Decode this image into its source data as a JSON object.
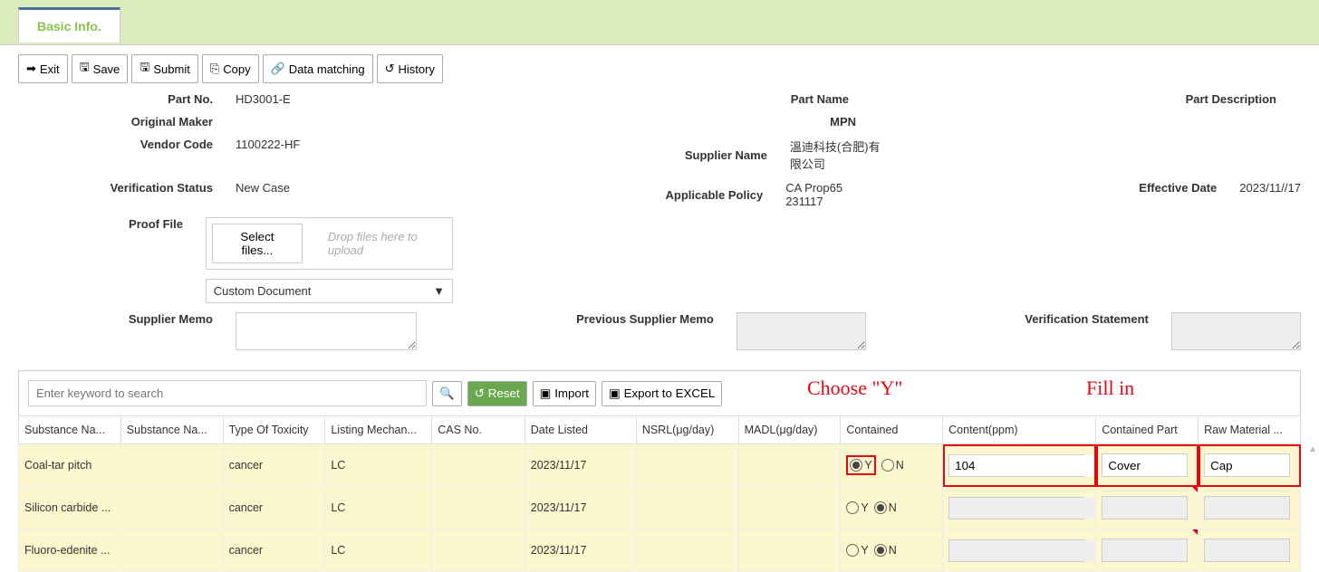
{
  "tab": "Basic Info.",
  "toolbar": {
    "exit": "Exit",
    "save": "Save",
    "submit": "Submit",
    "copy": "Copy",
    "data_matching": "Data matching",
    "history": "History"
  },
  "labels": {
    "part_no": "Part No.",
    "part_name": "Part Name",
    "part_desc": "Part Description",
    "original_maker": "Original Maker",
    "mpn": "MPN",
    "vendor_code": "Vendor Code",
    "supplier_name": "Supplier Name",
    "verification_status": "Verification Status",
    "applicable_policy": "Applicable Policy",
    "effective_date": "Effective Date",
    "proof_file": "Proof File",
    "supplier_memo": "Supplier Memo",
    "prev_supplier_memo": "Previous Supplier Memo",
    "verification_statement": "Verification Statement"
  },
  "values": {
    "part_no": "HD3001-E",
    "vendor_code": "1100222-HF",
    "supplier_name": "溫迪科技(合肥)有限公司",
    "verification_status": "New Case",
    "applicable_policy": "CA Prop65 231117",
    "effective_date": "2023/11//17",
    "select_files": "Select files...",
    "drop_hint": "Drop files here to upload",
    "doc_type": "Custom Document"
  },
  "grid_toolbar": {
    "search_placeholder": "Enter keyword to search",
    "reset": "Reset",
    "import": "Import",
    "export": "Export to EXCEL"
  },
  "annotations": {
    "choose_y": "Choose \"Y\"",
    "fill_in": "Fill in"
  },
  "columns": [
    "Substance Na...",
    "Substance Na...",
    "Type Of Toxicity",
    "Listing Mechan...",
    "CAS No.",
    "Date Listed",
    "NSRL(μg/day)",
    "MADL(μg/day)",
    "Contained",
    "Content(ppm)",
    "Contained Part",
    "Raw Material ..."
  ],
  "rows": [
    {
      "name": "Coal-tar pitch",
      "tox": "cancer",
      "mech": "LC",
      "date": "2023/11/17",
      "contained": "Y",
      "ppm": "104",
      "part": "Cover",
      "raw": "Cap",
      "highlight": true
    },
    {
      "name": "Silicon carbide ...",
      "tox": "cancer",
      "mech": "LC",
      "date": "2023/11/17",
      "contained": "N",
      "ppm": "",
      "part": "",
      "raw": "",
      "highlight": false
    },
    {
      "name": "Fluoro-edenite ...",
      "tox": "cancer",
      "mech": "LC",
      "date": "2023/11/17",
      "contained": "N",
      "ppm": "",
      "part": "",
      "raw": "",
      "highlight": false
    }
  ]
}
